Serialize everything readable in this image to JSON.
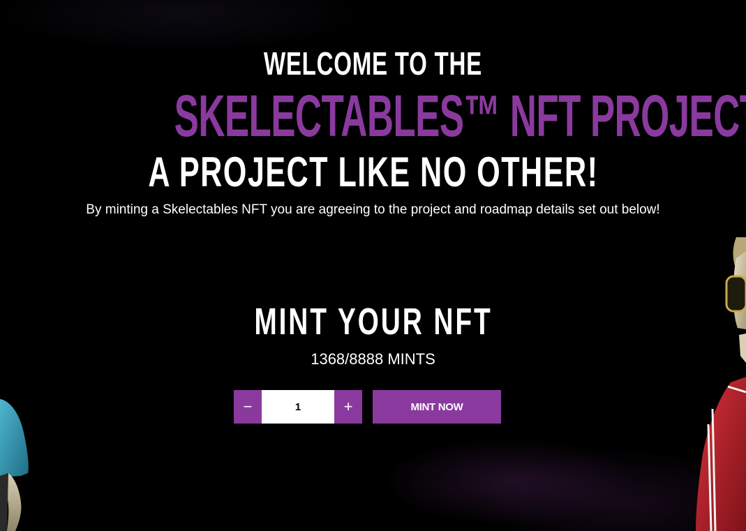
{
  "hero": {
    "welcome": "WELCOME TO THE",
    "project_name": "SKELECTABLES™ NFT PROJECT.",
    "tagline": "A PROJECT LIKE NO OTHER!",
    "intro": "By minting a Skelectables NFT you are agreeing to the project and roadmap details set out below!"
  },
  "mint": {
    "title": "MINT YOUR NFT",
    "count_text": "1368/8888 MINTS",
    "minted": 1368,
    "total_supply": 8888,
    "quantity": "1",
    "decrement_symbol": "−",
    "increment_symbol": "+",
    "mint_button_label": "MINT NOW"
  },
  "colors": {
    "accent_purple": "#8a3a9e",
    "background": "#000000",
    "text": "#ffffff"
  },
  "decorations": {
    "left_character": "skeleton-character-blue-shirt",
    "right_character": "skeleton-character-red-tracksuit-sunglasses"
  }
}
